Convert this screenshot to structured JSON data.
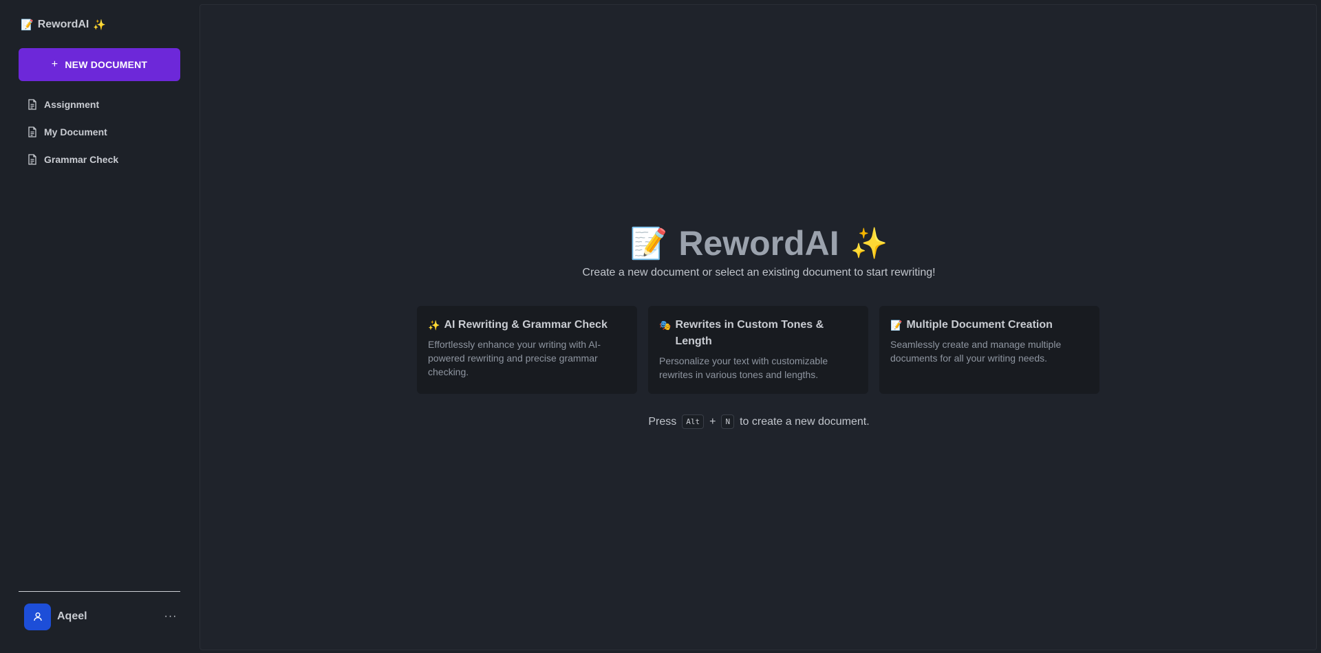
{
  "sidebar": {
    "brand_emoji_left": "📝",
    "brand_name": "RewordAI",
    "brand_emoji_right": "✨",
    "new_document_label": "NEW DOCUMENT",
    "documents": [
      {
        "label": "Assignment"
      },
      {
        "label": "My Document"
      },
      {
        "label": "Grammar Check"
      }
    ],
    "user": {
      "name": "Aqeel",
      "more": "···"
    }
  },
  "main": {
    "hero": {
      "emoji_left": "📝",
      "title": "RewordAI",
      "emoji_right": "✨"
    },
    "subtitle": "Create a new document or select an existing document to start rewriting!",
    "cards": [
      {
        "emoji": "✨",
        "title": "AI Rewriting & Grammar Check",
        "description": "Effortlessly enhance your writing with AI-powered rewriting and precise grammar checking."
      },
      {
        "emoji": "🎭",
        "title": "Rewrites in Custom Tones & Length",
        "description": "Personalize your text with customizable rewrites in various tones and lengths."
      },
      {
        "emoji": "📝",
        "title": "Multiple Document Creation",
        "description": "Seamlessly create and manage multiple documents for all your writing needs."
      }
    ],
    "shortcut": {
      "prefix": "Press",
      "key1": "Alt",
      "plus": "+",
      "key2": "N",
      "suffix": "to create a new document."
    }
  },
  "colors": {
    "accent": "#6d28d9",
    "avatar": "#1d4ed8",
    "background": "#1d2128"
  },
  "icons": {
    "document": "file-text-icon",
    "user": "user-icon",
    "plus": "plus-icon",
    "more": "ellipsis-icon"
  }
}
